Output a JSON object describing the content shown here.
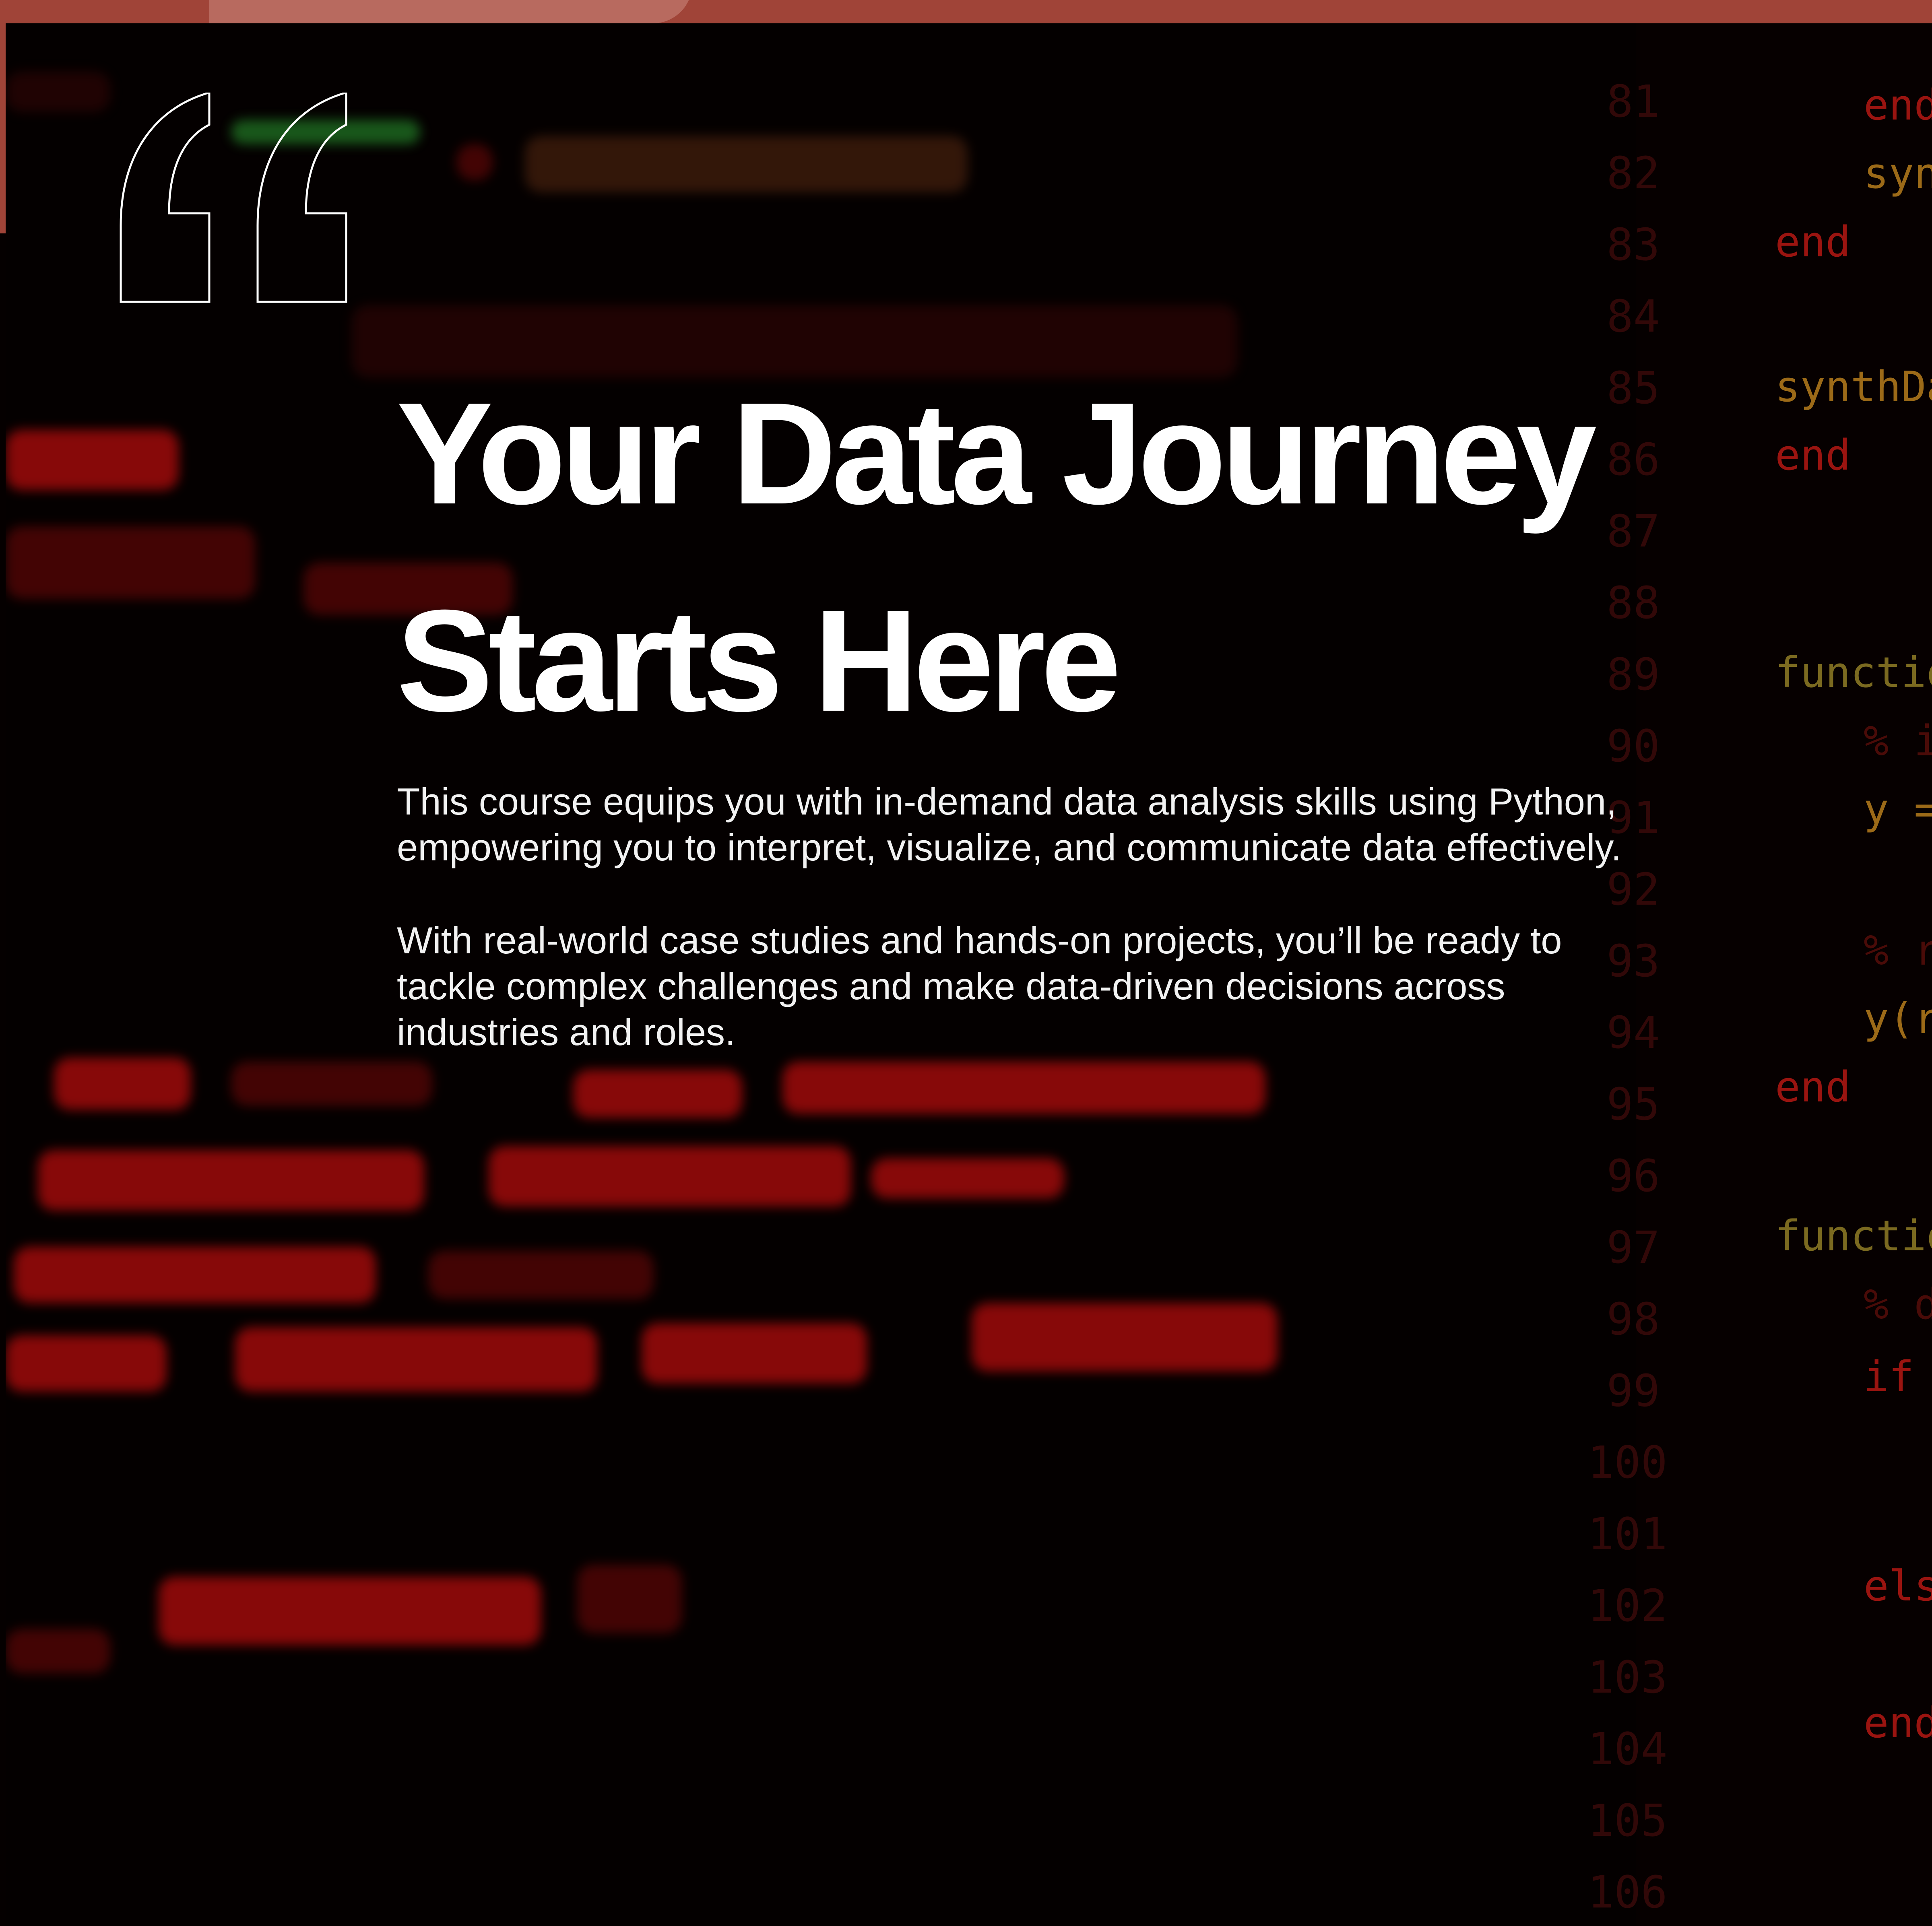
{
  "colors": {
    "frame": "#a04438",
    "background": "#040000",
    "code_red": "#b30c0c",
    "text": "#ffffff"
  },
  "quote_icon": "open-quote-icon",
  "headline": {
    "line1": "Your Data Journey",
    "line2": "Starts Here"
  },
  "body": {
    "paragraph1_line1": "This course equips you with in-demand data analysis skills using Python,",
    "paragraph1_line2": "empowering you to interpret, visualize, and communicate data effectively.",
    "paragraph2_line1": "With real-world case studies and hands-on projects, you’ll be ready to",
    "paragraph2_line2": "tackle complex challenges and make data-driven decisions across",
    "paragraph2_line3": "industries and roles."
  },
  "code_background": {
    "line_numbers": [
      "81",
      "82",
      "83",
      "84",
      "85",
      "86",
      "87",
      "88",
      "89",
      "90",
      "91",
      "92",
      "93",
      "94",
      "95",
      "96",
      "97",
      "98",
      "99",
      "100",
      "101",
      "102",
      "103",
      "104",
      "105",
      "106"
    ],
    "lines": [
      "end",
      "synt",
      "end",
      "synthDat",
      "end",
      "function",
      "% in",
      "y =",
      "% ra",
      "y(ra",
      "end",
      "function",
      "% de",
      "if",
      "else",
      "end"
    ],
    "blurred_fragments": [
      "nScans, 1), ...",
      "nScans,"
    ]
  }
}
